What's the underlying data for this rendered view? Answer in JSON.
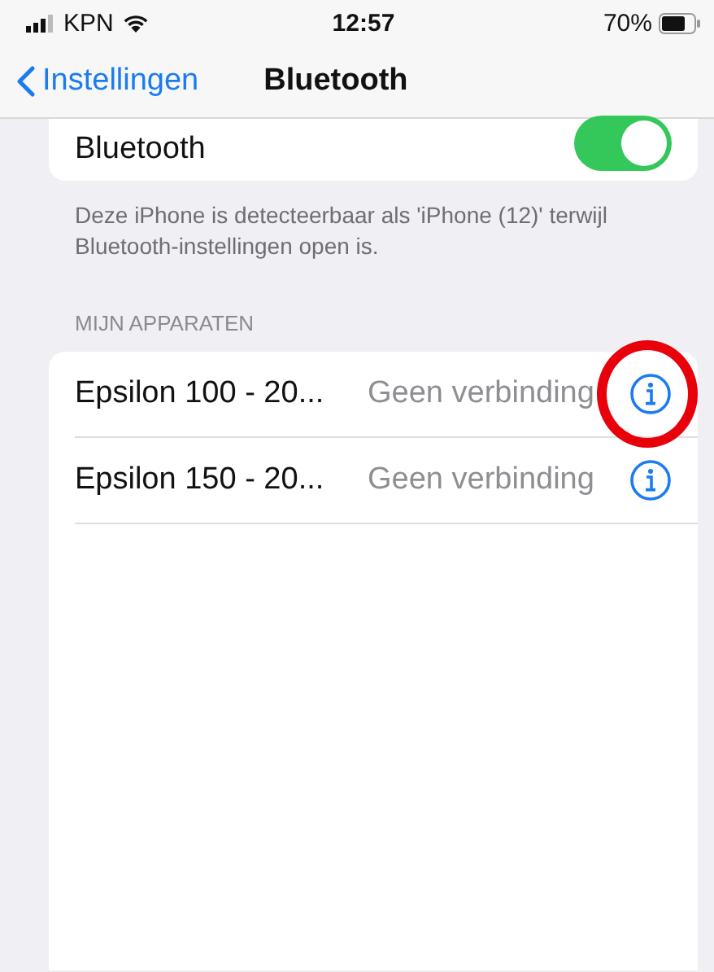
{
  "status_bar": {
    "carrier": "KPN",
    "time": "12:57",
    "battery": "70%"
  },
  "nav": {
    "back": "Instellingen",
    "title": "Bluetooth"
  },
  "bluetooth": {
    "label": "Bluetooth",
    "on": true
  },
  "footer": "Deze iPhone is detecteerbaar als 'iPhone (12)' terwijl Bluetooth-instellingen open is.",
  "section": "MIJN APPARATEN",
  "devices": [
    {
      "name": "Epsilon 100 - 20...",
      "status": "Geen verbinding",
      "circled": true
    },
    {
      "name": "Epsilon 150 - 20...",
      "status": "Geen verbinding",
      "circled": false
    }
  ]
}
